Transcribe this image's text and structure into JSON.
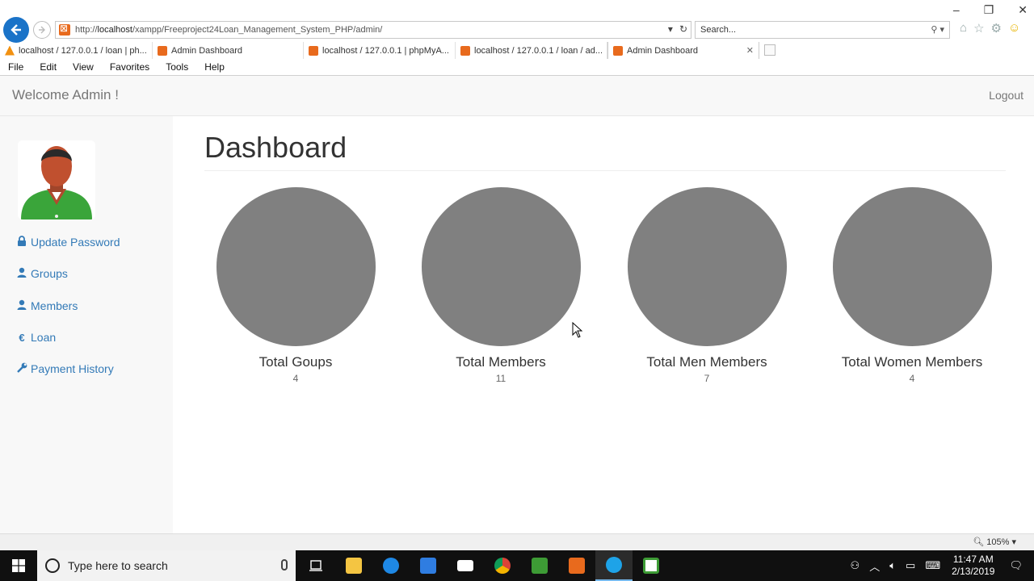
{
  "browser": {
    "url_prefix": "http://",
    "url_host": "localhost",
    "url_path": "/xampp/Freeproject24Loan_Management_System_PHP/admin/",
    "search_placeholder": "Search...",
    "tabs": [
      {
        "label": "localhost / 127.0.0.1 / loan | ph...",
        "icon": "phpmyadmin-icon",
        "active": false
      },
      {
        "label": "Admin Dashboard",
        "icon": "xampp-icon",
        "active": false
      },
      {
        "label": "localhost / 127.0.0.1 | phpMyA...",
        "icon": "xampp-icon",
        "active": false
      },
      {
        "label": "localhost / 127.0.0.1 / loan / ad...",
        "icon": "xampp-icon",
        "active": false
      },
      {
        "label": "Admin Dashboard",
        "icon": "xampp-icon",
        "active": true
      }
    ],
    "menu": [
      "File",
      "Edit",
      "View",
      "Favorites",
      "Tools",
      "Help"
    ],
    "zoom": "105%"
  },
  "navbar": {
    "welcome": "Welcome Admin !",
    "logout": "Logout"
  },
  "sidebar": {
    "items": [
      {
        "label": "Update Password",
        "icon": "lock-icon"
      },
      {
        "label": "Groups",
        "icon": "user-icon"
      },
      {
        "label": "Members",
        "icon": "user-icon"
      },
      {
        "label": "Loan",
        "icon": "euro-icon"
      },
      {
        "label": "Payment History",
        "icon": "wrench-icon"
      }
    ]
  },
  "dashboard": {
    "title": "Dashboard",
    "stats": [
      {
        "label": "Total Goups",
        "value": "4"
      },
      {
        "label": "Total Members",
        "value": "11"
      },
      {
        "label": "Total Men Members",
        "value": "7"
      },
      {
        "label": "Total Women Members",
        "value": "4"
      }
    ]
  },
  "taskbar": {
    "search_placeholder": "Type here to search",
    "time": "11:47 AM",
    "date": "2/13/2019"
  },
  "colors": {
    "link": "#337ab7",
    "circle": "#808080",
    "back_button": "#1a73c8"
  }
}
